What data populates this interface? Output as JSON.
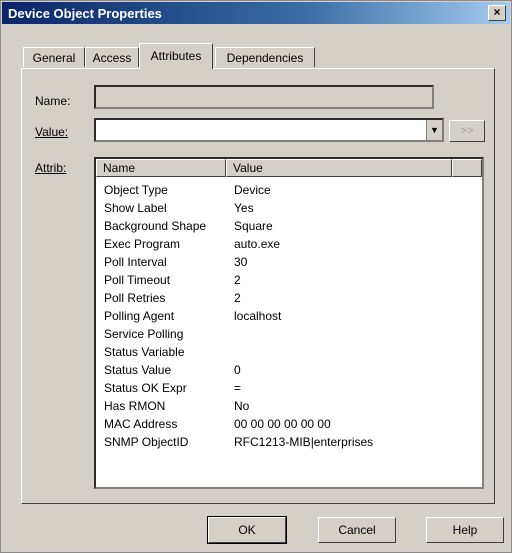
{
  "window": {
    "title": "Device Object Properties",
    "close_glyph": "×"
  },
  "tabs": [
    {
      "label": "General"
    },
    {
      "label": "Access"
    },
    {
      "label": "Attributes",
      "active": true
    },
    {
      "label": "Dependencies"
    }
  ],
  "form": {
    "name_label": "Name:",
    "name_value": "",
    "value_label": "Value:",
    "value_value": "",
    "more_button": ">>",
    "attrib_label": "Attrib:"
  },
  "attrib_list": {
    "headers": [
      "Name",
      "Value"
    ],
    "rows": [
      {
        "name": "Object Type",
        "value": "Device"
      },
      {
        "name": "Show Label",
        "value": "Yes"
      },
      {
        "name": "Background Shape",
        "value": "Square"
      },
      {
        "name": "Exec Program",
        "value": "auto.exe"
      },
      {
        "name": "Poll Interval",
        "value": "30"
      },
      {
        "name": "Poll Timeout",
        "value": "2"
      },
      {
        "name": "Poll Retries",
        "value": "2"
      },
      {
        "name": "Polling Agent",
        "value": "localhost"
      },
      {
        "name": "Service Polling",
        "value": ""
      },
      {
        "name": "Status Variable",
        "value": ""
      },
      {
        "name": "Status Value",
        "value": "0"
      },
      {
        "name": "Status OK Expr",
        "value": "="
      },
      {
        "name": "Has RMON",
        "value": "No"
      },
      {
        "name": "MAC Address",
        "value": "00 00 00 00 00 00"
      },
      {
        "name": "SNMP ObjectID",
        "value": "RFC1213-MIB|enterprises"
      }
    ]
  },
  "buttons": {
    "ok": "OK",
    "cancel": "Cancel",
    "help": "Help"
  },
  "icons": {
    "close": "close-icon",
    "dropdown": "chevron-down-icon"
  },
  "colors": {
    "titlebar_start": "#0a246a",
    "titlebar_end": "#a6caf0",
    "dialog": "#d4d0c8"
  }
}
